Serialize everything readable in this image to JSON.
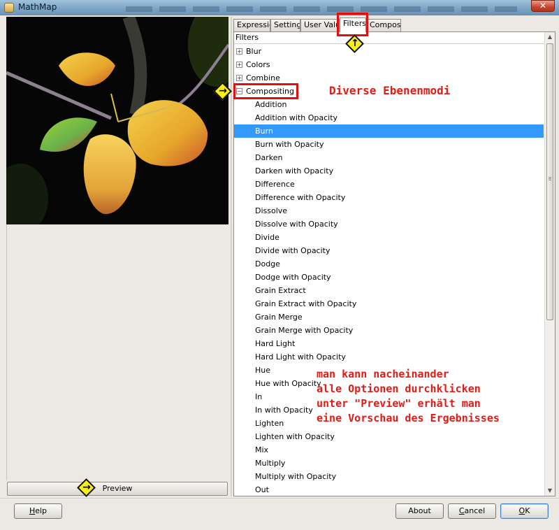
{
  "window": {
    "title": "MathMap",
    "close_glyph": "✕"
  },
  "preview": {
    "button_label": "Preview",
    "image_icon": "autumn-leaves-photo"
  },
  "tabs": [
    {
      "label": "Expression"
    },
    {
      "label": "Settings"
    },
    {
      "label": "User Value"
    },
    {
      "label": "Filters",
      "active": true
    },
    {
      "label": "Composer"
    }
  ],
  "tree": {
    "header": "Filters",
    "categories": [
      {
        "label": "Blur",
        "expander": "+"
      },
      {
        "label": "Colors",
        "expander": "+"
      },
      {
        "label": "Combine",
        "expander": "+"
      },
      {
        "label": "Compositing",
        "expander": "−"
      }
    ],
    "items": [
      "Addition",
      "Addition with Opacity",
      "Burn",
      "Burn with Opacity",
      "Darken",
      "Darken with Opacity",
      "Difference",
      "Difference with Opacity",
      "Dissolve",
      "Dissolve with Opacity",
      "Divide",
      "Divide with Opacity",
      "Dodge",
      "Dodge with Opacity",
      "Grain Extract",
      "Grain Extract with Opacity",
      "Grain Merge",
      "Grain Merge with Opacity",
      "Hard Light",
      "Hard Light with Opacity",
      "Hue",
      "Hue with Opacity",
      "In",
      "In with Opacity",
      "Lighten",
      "Lighten with Opacity",
      "Mix",
      "Multiply",
      "Multiply with Opacity",
      "Out"
    ],
    "selected": "Burn"
  },
  "buttons": {
    "help": {
      "label": "Help",
      "mnemonic": "H",
      "rest": "elp"
    },
    "about": {
      "label": "About"
    },
    "cancel": {
      "label": "Cancel",
      "mnemonic": "C",
      "rest": "ancel"
    },
    "ok": {
      "label": "OK",
      "mnemonic": "O",
      "rest": "K"
    }
  },
  "annotations": {
    "layer_modes": "Diverse Ebenenmodi",
    "instructions": "man kann nacheinander\nalle Optionen durchklicken\nunter \"Preview\" erhält man\neine Vorschau des Ergebnisses",
    "color": "#e21b14",
    "marker_color": "#f7ef1a",
    "marker_up_glyph": "↑",
    "marker_right_glyph": "→"
  },
  "colors": {
    "selection": "#3399ff",
    "window_bg": "#ece9e4"
  }
}
